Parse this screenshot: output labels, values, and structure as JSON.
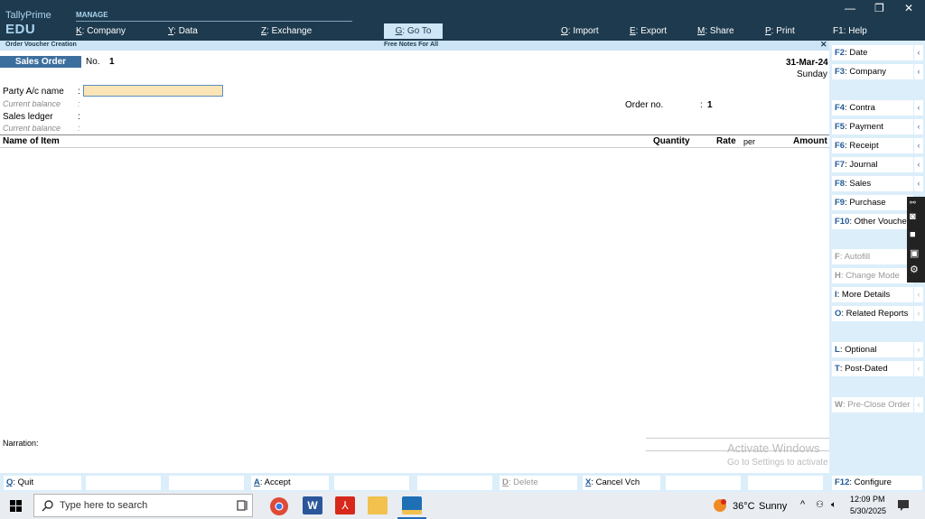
{
  "app": {
    "logo_line1": "TallyPrime",
    "logo_line2": "EDU",
    "section": "MANAGE"
  },
  "top_menu": [
    {
      "key": "K",
      "label": "Company"
    },
    {
      "key": "Y",
      "label": "Data"
    },
    {
      "key": "Z",
      "label": "Exchange"
    },
    {
      "key": "G",
      "label": "Go To"
    },
    {
      "key": "O",
      "label": "Import"
    },
    {
      "key": "E",
      "label": "Export"
    },
    {
      "key": "M",
      "label": "Share"
    },
    {
      "key": "P",
      "label": "Print"
    },
    {
      "key": "F1",
      "label": "Help"
    }
  ],
  "window_controls": {
    "minimize": "—",
    "restore": "❐",
    "close": "✕"
  },
  "title_bar": {
    "left": "Order Voucher Creation",
    "center": "Free Notes For All",
    "close": "✕"
  },
  "voucher": {
    "type": "Sales Order",
    "no_label": "No.",
    "no_value": "1",
    "date": "31-Mar-24",
    "day": "Sunday",
    "party_label": "Party A/c name",
    "colon": ":",
    "party_value": "",
    "current_balance_label": "Current balance",
    "sales_ledger_label": "Sales ledger",
    "order_no_label": "Order no.",
    "order_no_value": "1",
    "narration_label": "Narration:"
  },
  "table": {
    "headers": {
      "item": "Name of Item",
      "quantity": "Quantity",
      "rate": "Rate",
      "per": "per",
      "amount": "Amount"
    }
  },
  "right_panel": [
    {
      "key": "F2",
      "label": "Date",
      "disabled": false
    },
    {
      "key": "F3",
      "label": "Company",
      "disabled": false
    },
    {
      "key": "F4",
      "label": "Contra",
      "disabled": false
    },
    {
      "key": "F5",
      "label": "Payment",
      "disabled": false
    },
    {
      "key": "F6",
      "label": "Receipt",
      "disabled": false
    },
    {
      "key": "F7",
      "label": "Journal",
      "disabled": false
    },
    {
      "key": "F8",
      "label": "Sales",
      "disabled": false
    },
    {
      "key": "F9",
      "label": "Purchase",
      "disabled": false
    },
    {
      "key": "F10",
      "label": "Other Vouchers",
      "disabled": false
    },
    {
      "key": "F",
      "label": "Autofill",
      "disabled": true
    },
    {
      "key": "H",
      "label": "Change Mode",
      "disabled": true
    },
    {
      "key": "I",
      "label": "More Details",
      "disabled": false
    },
    {
      "key": "O",
      "label": "Related Reports",
      "disabled": false
    },
    {
      "key": "L",
      "label": "Optional",
      "disabled": false
    },
    {
      "key": "T",
      "label": "Post-Dated",
      "disabled": false
    },
    {
      "key": "W",
      "label": "Pre-Close Order",
      "disabled": true
    },
    {
      "key": "F12",
      "label": "Configure",
      "disabled": false
    }
  ],
  "bottom_bar": [
    {
      "key": "Q",
      "label": "Quit",
      "disabled": false
    },
    {
      "key": "A",
      "label": "Accept",
      "disabled": false
    },
    {
      "key": "D",
      "label": "Delete",
      "disabled": true
    },
    {
      "key": "X",
      "label": "Cancel Vch",
      "disabled": false
    }
  ],
  "watermark": {
    "title": "Activate Windows",
    "subtitle": "Go to Settings to activate Windows."
  },
  "taskbar": {
    "search_placeholder": "Type here to search",
    "weather_temp": "36°C",
    "weather_text": "Sunny",
    "time": "12:09 PM",
    "date": "5/30/2025",
    "colors": {
      "chrome": "#de4b39",
      "word": "#2b579a",
      "acrobat": "#d7281b",
      "explorer": "#f2c14e",
      "tally": "#1f6fb5"
    }
  }
}
